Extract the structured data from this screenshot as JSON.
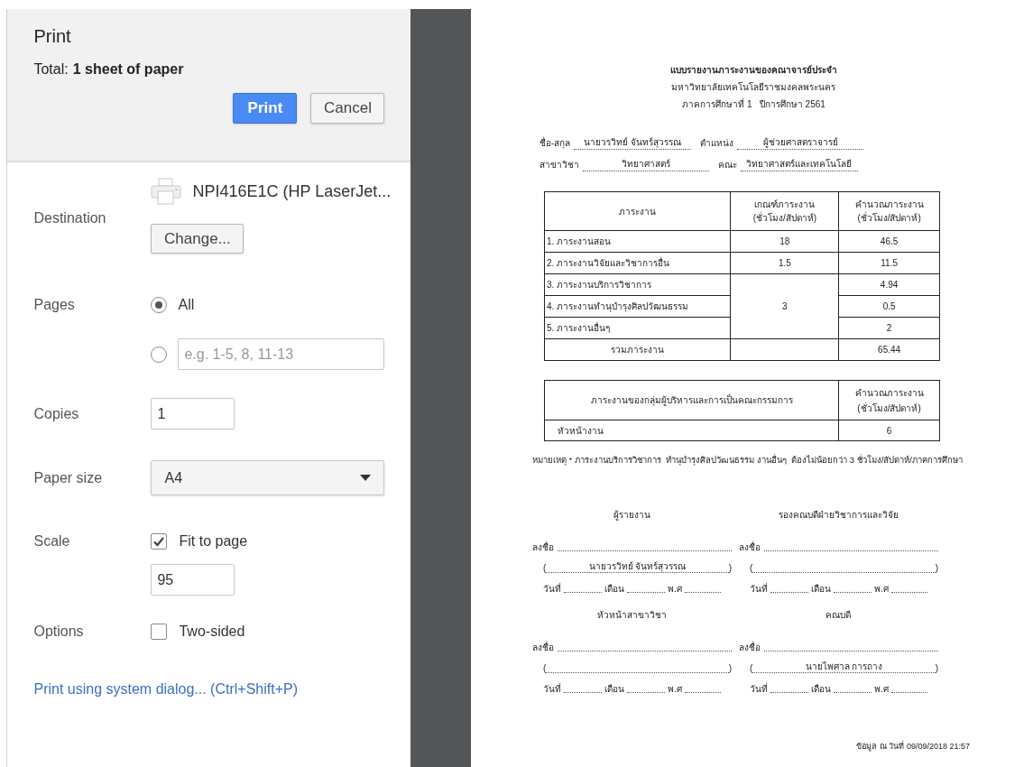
{
  "dialog": {
    "title": "Print",
    "total_label": "Total:",
    "total_value": "1 sheet of paper",
    "buttons": [
      {
        "kind": "primary",
        "label": "Print"
      },
      {
        "kind": "secondary",
        "label": "Cancel"
      }
    ]
  },
  "settings": [
    {
      "kind": "destination",
      "label": "Destination",
      "printer": "NPI416E1C (HP LaserJet...",
      "button": "Change..."
    },
    {
      "kind": "pages",
      "label": "Pages",
      "options": [
        {
          "label": "All",
          "selected": true
        },
        {
          "placeholder": "e.g. 1-5, 8, 11-13",
          "selected": false
        }
      ]
    },
    {
      "kind": "input",
      "label": "Copies",
      "value": "1"
    },
    {
      "kind": "select",
      "label": "Paper size",
      "value": "A4"
    },
    {
      "kind": "scale",
      "label": "Scale",
      "checkbox": {
        "label": "Fit to page",
        "checked": true
      },
      "value": "95"
    },
    {
      "kind": "checkbox",
      "label": "Options",
      "checkbox": {
        "label": "Two-sided",
        "checked": false
      }
    }
  ],
  "system_dialog_link": "Print using system dialog... (Ctrl+Shift+P)",
  "document": {
    "heading": [
      "แบบรายงานภาระงานของคณาจารย์ประจำ",
      "มหาวิทยาลัยเทคโนโลยีราชมงคลพระนคร",
      "ภาคการศึกษาที่ 1   ปีการศึกษา 2561"
    ],
    "info_rows": [
      [
        {
          "label": "ชื่อ-สกุล",
          "value": "นายวรวิทย์ จันทร์สุวรรณ"
        },
        {
          "label": "ตำแหน่ง",
          "value": "ผู้ช่วยศาสตราจารย์"
        }
      ],
      [
        {
          "label": "สาขาวิชา",
          "value": "วิทยาศาสตร์"
        },
        {
          "label": "คณะ",
          "value": "วิทยาศาสตร์และเทคโนโลยี"
        }
      ]
    ],
    "workload_table": {
      "columns": [
        "ภาระงาน",
        "เกณฑ์ภาระงาน\n(ชั่วโมง/สัปดาห์)",
        "คำนวณภาระงาน\n(ชั่วโมง/สัปดาห์)"
      ],
      "rows": [
        {
          "kind": "item",
          "task": "1. ภาระงานสอน",
          "criteria": "18",
          "calculated": "46.5"
        },
        {
          "kind": "item",
          "task": "2. ภาระงานวิจัยและวิชาการอื่น",
          "criteria": "1.5",
          "calculated": "11.5"
        },
        {
          "kind": "item",
          "task": "3. ภาระงานบริการวิชาการ",
          "criteria": "3",
          "calculated": "4.94"
        },
        {
          "kind": "item",
          "task": "4. ภาระงานทำนุบำรุงศิลปวัฒนธรรม",
          "calculated": "0.5"
        },
        {
          "kind": "item",
          "task": "5. ภาระงานอื่นๆ",
          "calculated": "2"
        },
        {
          "kind": "total",
          "task": "รวมภาระงาน",
          "calculated": "65.44"
        }
      ]
    },
    "admin_table": {
      "columns": [
        "ภาระงานของกลุ่มผู้บริหารและการเป็นคณะกรรมการ",
        "คำนวณภาระงาน\n(ชั่วโมง/สัปดาห์)"
      ],
      "rows": [
        {
          "role": "หัวหน้างาน",
          "calculated": "6"
        }
      ]
    },
    "note": "หมายเหตุ * ภาระงานบริการวิชาการ  ทำนุบำรุงศิลปวัฒนธรรม งานอื่นๆ  ต้องไม่น้อยกว่า 3 ชั่วโมง/สัปดาห์/ภาคการศึกษา",
    "signatures": [
      {
        "title": "ผู้รายงาน",
        "sign_label": "ลงชื่อ",
        "open": "(",
        "name": "นายวรวิทย์ จันทร์สุวรรณ",
        "close": ")",
        "date_labels": [
          "วันที่",
          "เดือน",
          "พ.ศ"
        ]
      },
      {
        "title": "รองคณบดีฝ่ายวิชาการและวิจัย",
        "sign_label": "ลงชื่อ",
        "open": "(",
        "close": ")",
        "date_labels": [
          "วันที่",
          "เดือน",
          "พ.ศ"
        ]
      },
      {
        "title": "หัวหน้าสาขาวิชา",
        "sign_label": "ลงชื่อ",
        "open": "(",
        "close": ")",
        "date_labels": [
          "วันที่",
          "เดือน",
          "พ.ศ"
        ]
      },
      {
        "title": "คณบดี",
        "sign_label": "ลงชื่อ",
        "open": "(",
        "name": "นายไพศาล การถาง",
        "close": ")",
        "date_labels": [
          "วันที่",
          "เดือน",
          "พ.ศ"
        ]
      }
    ],
    "footer": "ข้อมูล ณ วันที่ 09/09/2018 21:57"
  }
}
